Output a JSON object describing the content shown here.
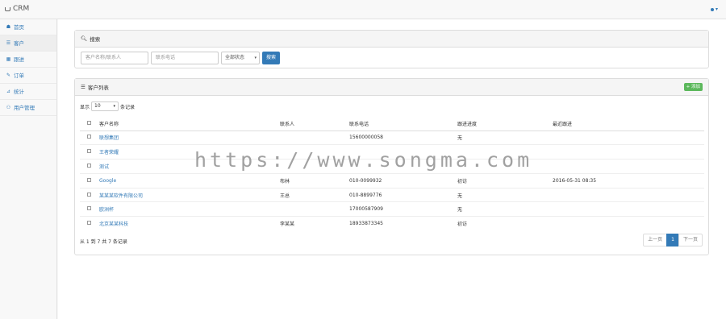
{
  "app": {
    "title": "CRM",
    "user_caret": "▾"
  },
  "sidebar": {
    "items": [
      {
        "icon": "☗",
        "label": "首页",
        "active": false
      },
      {
        "icon": "☰",
        "label": "客户",
        "active": true
      },
      {
        "icon": "▦",
        "label": "跟进",
        "active": false
      },
      {
        "icon": "✎",
        "label": "订单",
        "active": false
      },
      {
        "icon": "⊿",
        "label": "统计",
        "active": false
      },
      {
        "icon": "⚇",
        "label": "用户管理",
        "active": false
      }
    ]
  },
  "search": {
    "heading": "搜索",
    "name_placeholder": "客户名称/联系人",
    "phone_placeholder": "联系电话",
    "status_value": "全部状态",
    "submit_label": "搜索"
  },
  "customer_list": {
    "heading": "客户列表",
    "add_label": "+ 添加",
    "length_prefix": "显示",
    "length_value": "10",
    "length_suffix": "条记录",
    "columns": [
      "客户名称",
      "联系人",
      "联系电话",
      "跟进进度",
      "最近跟进"
    ],
    "rows": [
      {
        "name": "联想集团",
        "contact": "",
        "phone": "15600000058",
        "progress": "无",
        "last_follow": ""
      },
      {
        "name": "王者荣耀",
        "contact": "",
        "phone": "",
        "progress": "",
        "last_follow": ""
      },
      {
        "name": "测试",
        "contact": "",
        "phone": "",
        "progress": "",
        "last_follow": ""
      },
      {
        "name": "Google",
        "contact": "布林",
        "phone": "010-0099932",
        "progress": "初访",
        "last_follow": "2016-05-31 08:35"
      },
      {
        "name": "某某某软件有限公司",
        "contact": "王总",
        "phone": "010-8899776",
        "progress": "无",
        "last_follow": ""
      },
      {
        "name": "欧洲杯",
        "contact": "",
        "phone": "17000587909",
        "progress": "无",
        "last_follow": ""
      },
      {
        "name": "北京某某科技",
        "contact": "李某某",
        "phone": "18933873345",
        "progress": "初访",
        "last_follow": ""
      }
    ],
    "info": "从 1 到 7 共 7 条记录",
    "pager": {
      "prev": "上一页",
      "current": "1",
      "next": "下一页"
    }
  },
  "watermark": "https://www.songma.com"
}
